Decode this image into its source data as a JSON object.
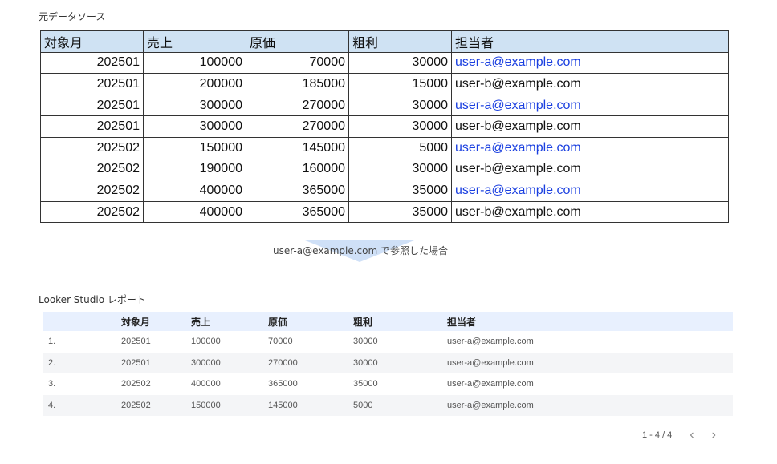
{
  "source": {
    "label": "元データソース",
    "headers": [
      "対象月",
      "売上",
      "原価",
      "粗利",
      "担当者"
    ],
    "rows": [
      [
        "202501",
        "100000",
        "70000",
        "30000",
        "user-a@example.com"
      ],
      [
        "202501",
        "200000",
        "185000",
        "15000",
        "user-b@example.com"
      ],
      [
        "202501",
        "300000",
        "270000",
        "30000",
        "user-a@example.com"
      ],
      [
        "202501",
        "300000",
        "270000",
        "30000",
        "user-b@example.com"
      ],
      [
        "202502",
        "150000",
        "145000",
        "5000",
        "user-a@example.com"
      ],
      [
        "202502",
        "190000",
        "160000",
        "30000",
        "user-b@example.com"
      ],
      [
        "202502",
        "400000",
        "365000",
        "35000",
        "user-a@example.com"
      ],
      [
        "202502",
        "400000",
        "365000",
        "35000",
        "user-b@example.com"
      ]
    ]
  },
  "arrow": {
    "caption": "user-a@example.com で参照した場合",
    "color": "#cfe0f7"
  },
  "report": {
    "label": "Looker Studio レポート",
    "headers": [
      "",
      "対象月",
      "売上",
      "原価",
      "粗利",
      "担当者"
    ],
    "rows": [
      [
        "1.",
        "202501",
        "100000",
        "70000",
        "30000",
        "user-a@example.com"
      ],
      [
        "2.",
        "202501",
        "300000",
        "270000",
        "30000",
        "user-a@example.com"
      ],
      [
        "3.",
        "202502",
        "400000",
        "365000",
        "35000",
        "user-a@example.com"
      ],
      [
        "4.",
        "202502",
        "150000",
        "145000",
        "5000",
        "user-a@example.com"
      ]
    ],
    "pager": {
      "range": "1 - 4 / 4",
      "prev_icon": "chevron-left-icon",
      "next_icon": "chevron-right-icon"
    }
  },
  "colors": {
    "source_header_bg": "#cfe2f3",
    "user_a_text": "#1a3fe0",
    "report_header_bg": "#e8f0fe",
    "report_alt_row_bg": "#f4f5f7"
  }
}
